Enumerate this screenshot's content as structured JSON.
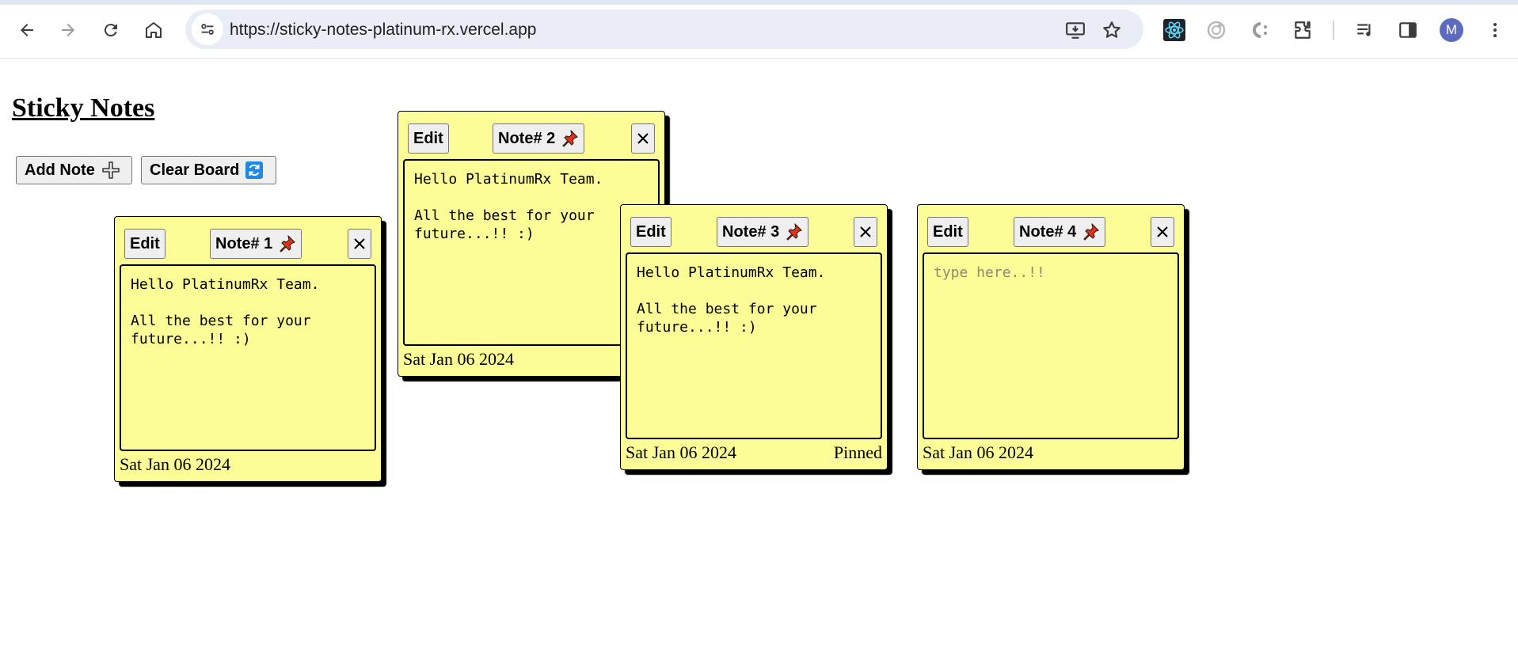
{
  "browser": {
    "url": "https://sticky-notes-platinum-rx.vercel.app",
    "avatar_letter": "M",
    "icons": [
      "back-icon",
      "forward-icon",
      "reload-icon",
      "home-icon",
      "site-info-icon",
      "install-app-icon",
      "bookmark-star-icon",
      "react-devtools-icon",
      "extension-icon",
      "extension-icon",
      "extensions-puzzle-icon",
      "media-controls-icon",
      "side-panel-icon",
      "more-menu-icon"
    ]
  },
  "page": {
    "title": "Sticky Notes",
    "add_note_label": "Add Note",
    "clear_board_label": "Clear Board"
  },
  "notes": [
    {
      "edit_label": "Edit",
      "title": "Note# 1",
      "close_label": "✕",
      "text": "Hello PlatinumRx Team.\n\nAll the best for your\nfuture...!! :)",
      "date": "Sat Jan 06 2024",
      "status": ""
    },
    {
      "edit_label": "Edit",
      "title": "Note# 2",
      "close_label": "✕",
      "text": "Hello PlatinumRx Team.\n\nAll the best for your\nfuture...!! :)",
      "date": "Sat Jan 06 2024",
      "status": ""
    },
    {
      "edit_label": "Edit",
      "title": "Note# 3",
      "close_label": "✕",
      "text": "Hello PlatinumRx Team.\n\nAll the best for your\nfuture...!! :)",
      "date": "Sat Jan 06 2024",
      "status": "Pinned"
    },
    {
      "edit_label": "Edit",
      "title": "Note# 4",
      "close_label": "✕",
      "text": "",
      "placeholder": "type here..!!",
      "date": "Sat Jan 06 2024",
      "status": ""
    }
  ],
  "colors": {
    "note_bg": "#fdfd98",
    "pin_red": "#e0321c",
    "clear_icon_blue": "#1e88e5"
  }
}
